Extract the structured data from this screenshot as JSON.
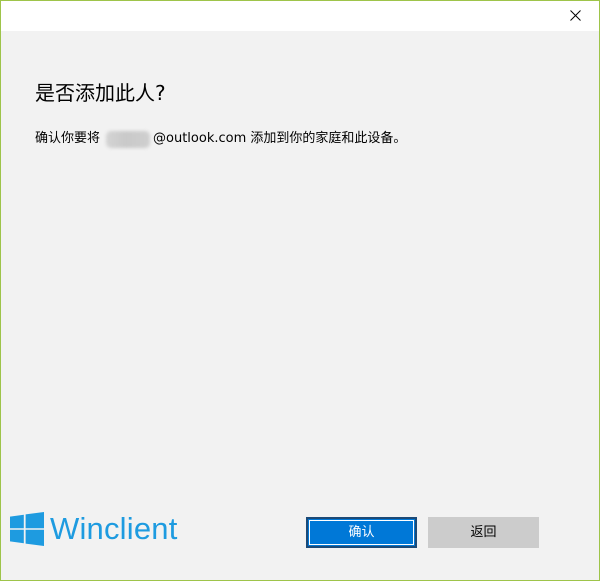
{
  "dialog": {
    "heading": "是否添加此人?",
    "message_prefix": "确认你要将",
    "message_email_domain": "@outlook.com",
    "message_suffix": " 添加到你的家庭和此设备。",
    "email_local_part": "(redacted)"
  },
  "buttons": {
    "ok_label": "确认",
    "back_label": "返回"
  },
  "titlebar": {
    "close_icon": "close-icon"
  },
  "watermark": {
    "text": "Winclient",
    "logo_icon": "windows-logo-icon"
  },
  "colors": {
    "accent": "#0078d7",
    "dialog_background": "#f2f2f2",
    "secondary_button": "#cccccc",
    "watermark": "#1e9be0",
    "window_border": "#9ec44a"
  }
}
